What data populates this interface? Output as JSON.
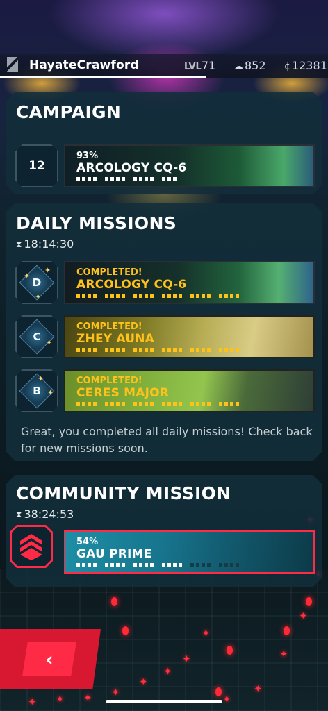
{
  "player": {
    "username": "HayateCrawford",
    "level_label": "LVL",
    "level": "71",
    "resource_value": "852",
    "credits_value": "12381"
  },
  "icons": {
    "logo": "slash-logo-icon",
    "resource": "rock-resource-icon",
    "credits": "credit-currency-icon",
    "hourglass": "hourglass-icon",
    "back": "chevron-left-icon"
  },
  "campaign": {
    "title": "CAMPAIGN",
    "badge_number": "12",
    "mission": {
      "progress_text": "93%",
      "progress": 0.93,
      "name": "ARCOLOGY CQ-6"
    }
  },
  "daily": {
    "title": "DAILY MISSIONS",
    "timer": "18:14:30",
    "missions": [
      {
        "grade": "D",
        "status": "COMPLETED!",
        "name": "ARCOLOGY CQ-6"
      },
      {
        "grade": "C",
        "status": "COMPLETED!",
        "name": "ZHEY AUNA"
      },
      {
        "grade": "B",
        "status": "COMPLETED!",
        "name": "CERES MAJOR"
      }
    ],
    "message": "Great, you completed all daily missions! Check back for new missions soon."
  },
  "community": {
    "title": "COMMUNITY MISSION",
    "timer": "38:24:53",
    "mission": {
      "progress_text": "54%",
      "progress": 0.54,
      "name": "GAU PRIME"
    }
  },
  "colors": {
    "accent_red": "#ff2a45",
    "gold": "#ffc21a",
    "panel": "#122e3a"
  }
}
